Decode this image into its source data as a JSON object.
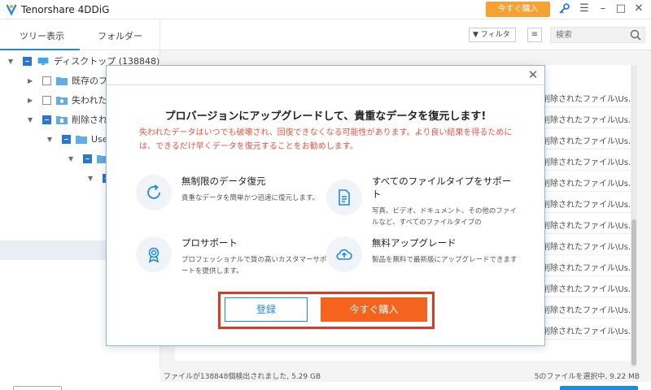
{
  "app": {
    "title": "Tenorshare 4DDiG",
    "buy_button": "今すぐ購入"
  },
  "tabs": [
    {
      "label": "ツリー表示"
    },
    {
      "label": "フォルダー"
    }
  ],
  "toolbar": {
    "filter_label": "フィルタ",
    "search_placeholder": "検索"
  },
  "tree": {
    "root": "ディスクトップ (138848)",
    "items": [
      {
        "label": "既存のフ"
      },
      {
        "label": "失われた"
      },
      {
        "label": "削除され"
      },
      {
        "label": "Use"
      }
    ]
  },
  "list": {
    "rows": [
      "削除されたファイル\\Us.",
      "削除されたファイル\\Us.",
      "削除されたファイル\\Us.",
      "削除されたファイル\\Us.",
      "削除されたファイル\\Us.",
      "削除されたファイル\\Us.",
      "削除されたファイル\\Us.",
      "削除されたファイル\\Us.",
      "削除されたファイル\\Us.",
      "削除されたファイル\\Us.",
      "削除されたファイル\\Us.",
      "削除されたファイル\\Us."
    ]
  },
  "status": {
    "left": "ファイルが138848個検出されました, 5.29 GB",
    "right": "5のファイルを選択中, 9.22 MB"
  },
  "modal": {
    "title": "プロバージョンにアップグレードして、貴重なデータを復元します!",
    "warning": "失われたデータはいつでも破壊され、回復できなくなる可能性があります。より良い結果を得るためには、できるだけ早くデータを復元することをお勧めします。",
    "features": [
      {
        "icon": "refresh-icon",
        "title": "無制限のデータ復元",
        "desc": "貴重なデータを簡単かつ迅速に復元します。"
      },
      {
        "icon": "document-icon",
        "title": "すべてのファイルタイプをサポート",
        "desc": "写真、ビデオ、ドキュメント、その他のファイルなど、すべてのファイルタイプの"
      },
      {
        "icon": "award-icon",
        "title": "プロサポート",
        "desc": "プロフェッショナルで質の高いカスタマーサポートを提供します。"
      },
      {
        "icon": "cloud-upload-icon",
        "title": "無料アップグレード",
        "desc": "製品を無料で最新版にアップグレードできます"
      }
    ],
    "register_label": "登録",
    "buy_label": "今すぐ購入"
  },
  "colors": {
    "accent": "#1c8ae3",
    "buy_orange": "#f5641e",
    "warning_red": "#e8533f",
    "highlight_red": "#d93a23",
    "top_buy": "#f7a133"
  }
}
